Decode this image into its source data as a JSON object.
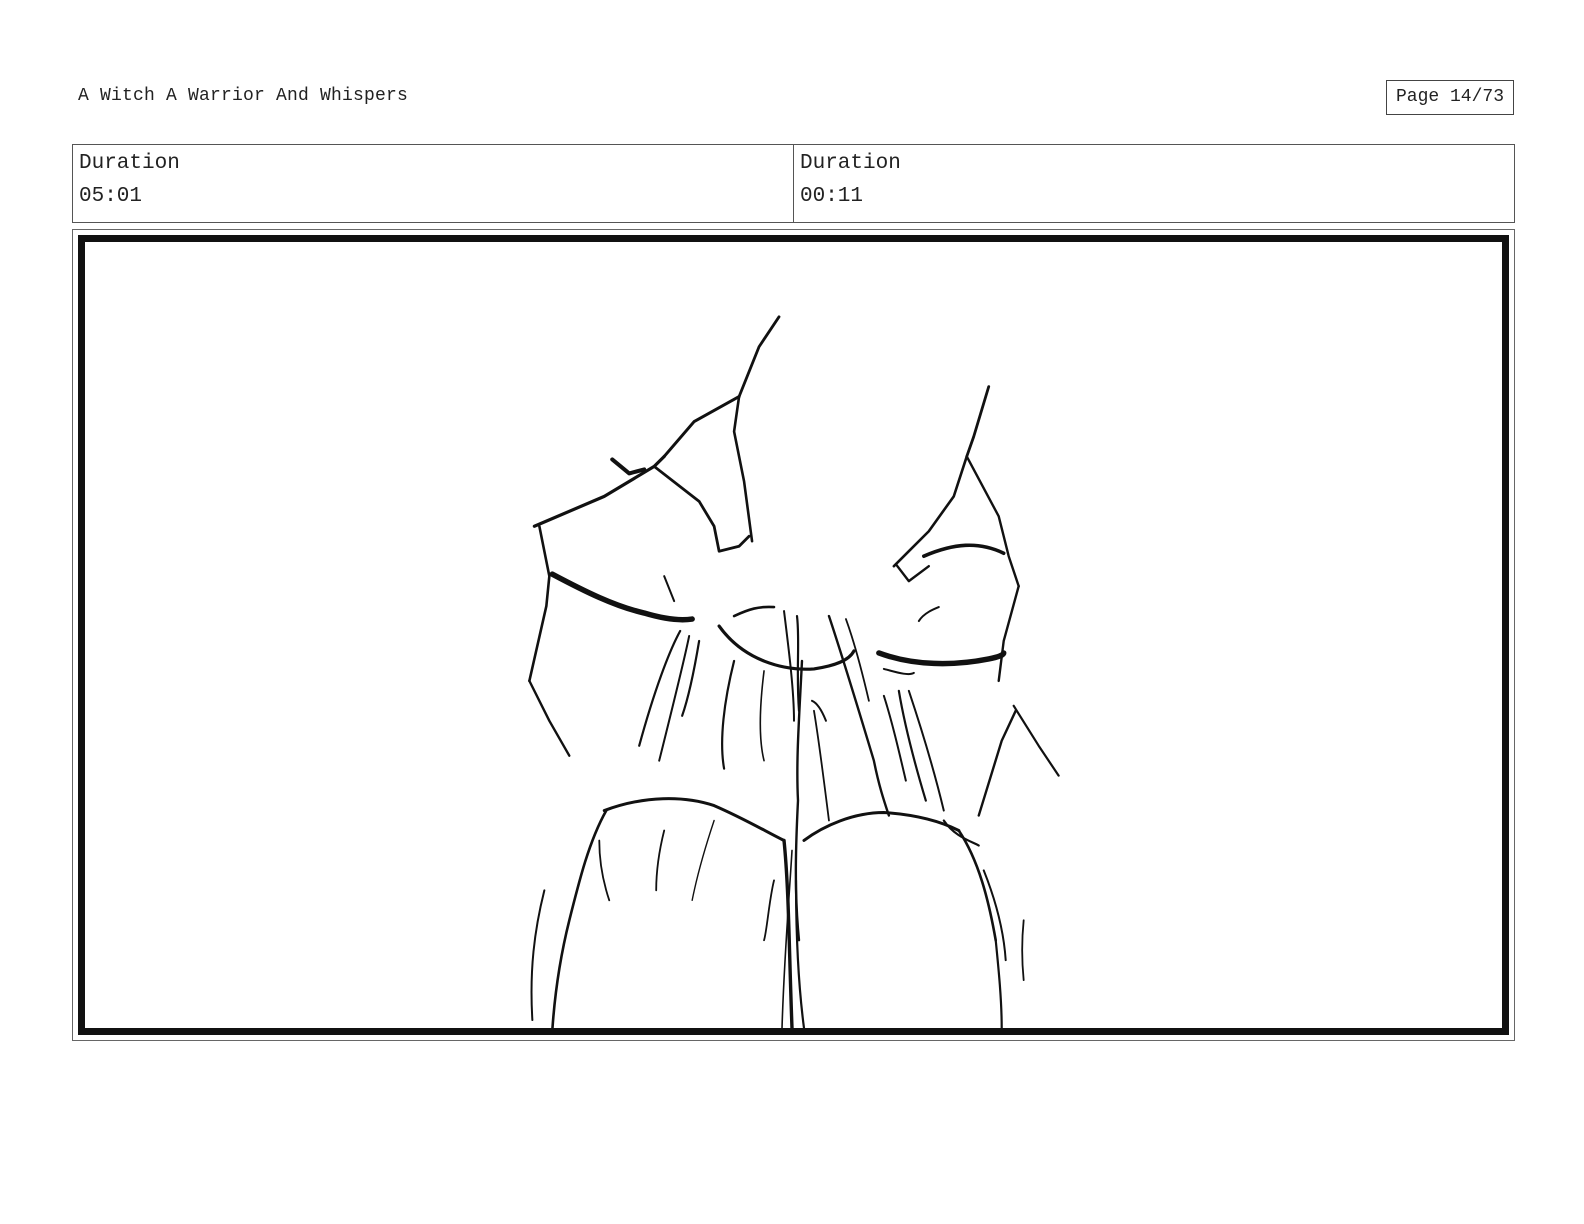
{
  "header": {
    "title": "A Witch A Warrior And Whispers",
    "page": "Page 14/73"
  },
  "panels": [
    {
      "label": "Duration",
      "value": "05:01"
    },
    {
      "label": "Duration",
      "value": "00:11"
    }
  ],
  "frame": {
    "icon": "sketch-drawing"
  }
}
